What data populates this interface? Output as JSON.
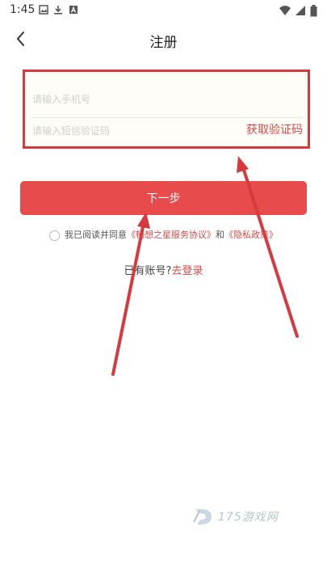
{
  "status_bar": {
    "time": "1:45",
    "left_icons": [
      "image-icon",
      "download-icon",
      "app-a-icon"
    ],
    "right_icons": [
      "wifi-icon",
      "signal-icon",
      "battery-icon"
    ]
  },
  "nav": {
    "title": "注册",
    "back_icon": "chevron-left-icon"
  },
  "form": {
    "phone_placeholder": "请输入手机号",
    "code_placeholder": "请输入短信验证码",
    "get_code_label": "获取验证码",
    "highlight_color": "#d63a3f"
  },
  "next_button": {
    "label": "下一步",
    "color": "#e84b4b"
  },
  "agreement": {
    "prefix": "我已阅读并同意",
    "service_link": "《畅想之星服务协议》",
    "middle": "和",
    "privacy_link": "《隐私政策》"
  },
  "login": {
    "prompt": "已有账号?",
    "link": "去登录"
  },
  "watermark": {
    "text": "175游戏网"
  },
  "colors": {
    "accent": "#e84b4b",
    "link": "#d84a4a",
    "annotation": "#d63a3f"
  }
}
